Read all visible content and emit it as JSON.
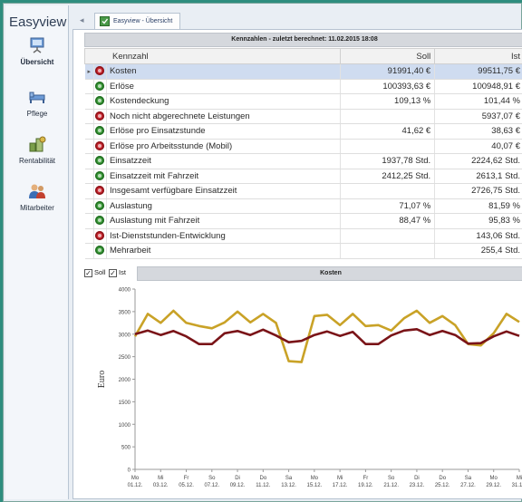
{
  "app": {
    "title": "Easyview"
  },
  "sidebar": {
    "items": [
      {
        "label": "Übersicht",
        "icon": "overview-icon",
        "active": true
      },
      {
        "label": "Pflege",
        "icon": "care-icon",
        "active": false
      },
      {
        "label": "Rentabilität",
        "icon": "profitability-icon",
        "active": false
      },
      {
        "label": "Mitarbeiter",
        "icon": "employees-icon",
        "active": false
      }
    ]
  },
  "tabs": [
    {
      "label": "Easyview - Übersicht",
      "active": true
    }
  ],
  "table": {
    "caption": "Kennzahlen - zuletzt berechnet: 11.02.2015 18:08",
    "columns": {
      "name": "Kennzahl",
      "soll": "Soll",
      "ist": "Ist"
    },
    "rows": [
      {
        "name": "Kosten",
        "soll": "91991,40 €",
        "ist": "99511,75 €",
        "status": "red",
        "selected": true
      },
      {
        "name": "Erlöse",
        "soll": "100393,63 €",
        "ist": "100948,91 €",
        "status": "green"
      },
      {
        "name": "Kostendeckung",
        "soll": "109,13 %",
        "ist": "101,44 %",
        "status": "green"
      },
      {
        "name": "Noch nicht abgerechnete Leistungen",
        "soll": "",
        "ist": "5937,07 €",
        "status": "red"
      },
      {
        "name": "Erlöse pro Einsatzstunde",
        "soll": "41,62 €",
        "ist": "38,63 €",
        "status": "green"
      },
      {
        "name": "Erlöse pro Arbeitsstunde (Mobil)",
        "soll": "",
        "ist": "40,07 €",
        "status": "red"
      },
      {
        "name": "Einsatzzeit",
        "soll": "1937,78 Std.",
        "ist": "2224,62 Std.",
        "status": "green"
      },
      {
        "name": "Einsatzzeit mit Fahrzeit",
        "soll": "2412,25 Std.",
        "ist": "2613,1 Std.",
        "status": "green"
      },
      {
        "name": "Insgesamt verfügbare Einsatzzeit",
        "soll": "",
        "ist": "2726,75 Std.",
        "status": "red"
      },
      {
        "name": "Auslastung",
        "soll": "71,07 %",
        "ist": "81,59 %",
        "status": "green"
      },
      {
        "name": "Auslastung mit Fahrzeit",
        "soll": "88,47 %",
        "ist": "95,83 %",
        "status": "green"
      },
      {
        "name": "Ist-Dienststunden-Entwicklung",
        "soll": "",
        "ist": "143,06 Std.",
        "status": "red"
      },
      {
        "name": "Mehrarbeit",
        "soll": "",
        "ist": "255,4 Std.",
        "status": "green"
      }
    ]
  },
  "chart_controls": {
    "soll_label": "Soll",
    "ist_label": "Ist",
    "soll_checked": true,
    "ist_checked": true
  },
  "chart_data": {
    "type": "line",
    "title": "Kosten",
    "ylabel": "Euro",
    "xlabel": "",
    "ylim": [
      0,
      4000
    ],
    "yticks": [
      0,
      500,
      1000,
      1500,
      2000,
      2500,
      3000,
      3500,
      4000
    ],
    "xtick_labels": [
      [
        "Mo",
        "01.12."
      ],
      [
        "Mi",
        "03.12."
      ],
      [
        "Fr",
        "05.12."
      ],
      [
        "So",
        "07.12."
      ],
      [
        "Di",
        "09.12."
      ],
      [
        "Do",
        "11.12."
      ],
      [
        "Sa",
        "13.12."
      ],
      [
        "Mo",
        "15.12."
      ],
      [
        "Mi",
        "17.12."
      ],
      [
        "Fr",
        "19.12."
      ],
      [
        "So",
        "21.12."
      ],
      [
        "Di",
        "23.12."
      ],
      [
        "Do",
        "25.12."
      ],
      [
        "Sa",
        "27.12."
      ],
      [
        "Mo",
        "29.12."
      ],
      [
        "Mi",
        "31.12."
      ]
    ],
    "x": [
      "01.12.",
      "02.12.",
      "03.12.",
      "04.12.",
      "05.12.",
      "06.12.",
      "07.12.",
      "08.12.",
      "09.12.",
      "10.12.",
      "11.12.",
      "12.12.",
      "13.12.",
      "14.12.",
      "15.12.",
      "16.12.",
      "17.12.",
      "18.12.",
      "19.12.",
      "20.12.",
      "21.12.",
      "22.12.",
      "23.12.",
      "24.12.",
      "25.12.",
      "26.12.",
      "27.12.",
      "28.12.",
      "29.12.",
      "30.12.",
      "31.12."
    ],
    "series": [
      {
        "name": "Ist",
        "color": "#c9a227",
        "values": [
          2950,
          3450,
          3250,
          3520,
          3250,
          3180,
          3130,
          3260,
          3500,
          3260,
          3450,
          3250,
          2400,
          2380,
          3400,
          3430,
          3200,
          3450,
          3180,
          3200,
          3080,
          3350,
          3520,
          3250,
          3400,
          3200,
          2780,
          2750,
          3020,
          3450,
          3270
        ]
      },
      {
        "name": "Soll",
        "color": "#7a1418",
        "values": [
          3000,
          3080,
          2980,
          3070,
          2950,
          2780,
          2780,
          3020,
          3070,
          2980,
          3100,
          2970,
          2820,
          2850,
          2980,
          3060,
          2960,
          3050,
          2780,
          2780,
          2970,
          3080,
          3110,
          2980,
          3070,
          2980,
          2790,
          2800,
          2950,
          3060,
          2960
        ]
      }
    ]
  },
  "colors": {
    "accent": "#2e8d7e",
    "selected_row": "#cfdcf0",
    "status_red": "#c8262f",
    "status_green": "#3c9c3a"
  }
}
